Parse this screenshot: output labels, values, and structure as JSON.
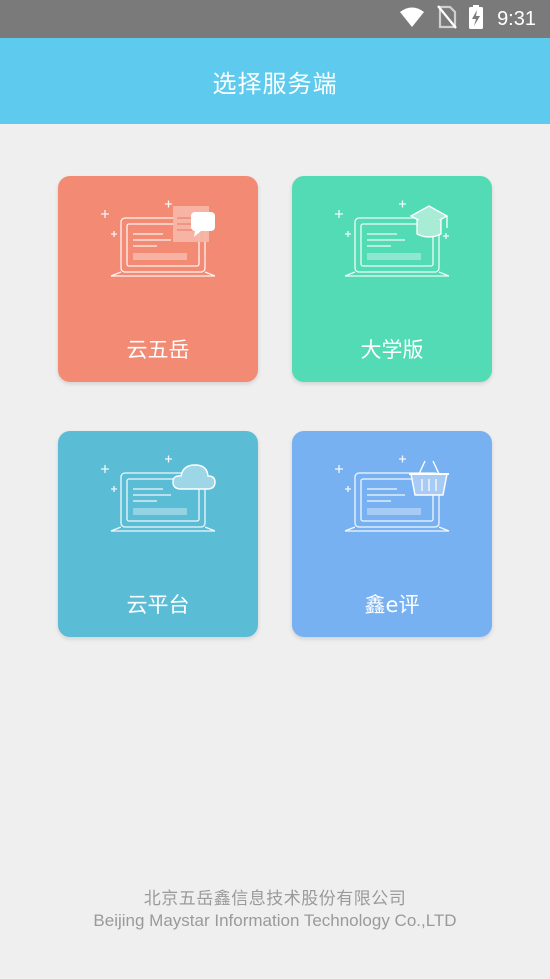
{
  "status_bar": {
    "time": "9:31",
    "icons": [
      "wifi-icon",
      "no-sim-icon",
      "battery-charging-icon"
    ]
  },
  "header": {
    "title": "选择服务端"
  },
  "servers": [
    {
      "label": "云五岳",
      "color": "#f28a74",
      "icon": "chat-bubble-laptop-icon"
    },
    {
      "label": "大学版",
      "color": "#52dbb4",
      "icon": "graduation-cap-laptop-icon"
    },
    {
      "label": "云平台",
      "color": "#5bbcd6",
      "icon": "cloud-laptop-icon"
    },
    {
      "label": "鑫e评",
      "color": "#77b1f1",
      "icon": "basket-laptop-icon"
    }
  ],
  "footer": {
    "company_cn": "北京五岳鑫信息技术股份有限公司",
    "company_en": "Beijing Maystar Information Technology Co.,LTD"
  }
}
